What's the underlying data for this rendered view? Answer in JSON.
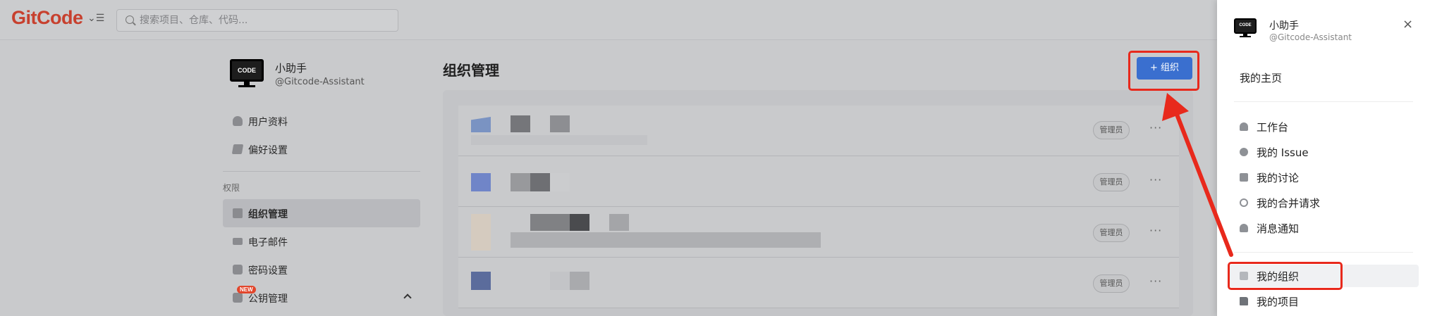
{
  "header": {
    "logo": "GitCode",
    "menu_toggle": "⌄☰",
    "search_placeholder": "搜索项目、仓库、代码..."
  },
  "profile": {
    "avatar_text": "CODE",
    "name": "小助手",
    "handle": "@Gitcode-Assistant"
  },
  "sidebar": {
    "items_top": [
      {
        "label": "用户资料"
      },
      {
        "label": "偏好设置"
      }
    ],
    "section_label": "权限",
    "items": [
      {
        "label": "组织管理"
      },
      {
        "label": "电子邮件"
      },
      {
        "label": "密码设置"
      },
      {
        "label": "公钥管理",
        "badge": "NEW"
      }
    ]
  },
  "main": {
    "title": "组织管理",
    "add_button": "+ 组织",
    "rows": [
      {
        "role": "管理员",
        "more": "···"
      },
      {
        "role": "管理员",
        "more": "···"
      },
      {
        "role": "管理员",
        "more": "···"
      },
      {
        "role": "管理员",
        "more": "···"
      }
    ]
  },
  "drawer": {
    "avatar_text": "CODE",
    "name": "小助手",
    "handle": "@Gitcode-Assistant",
    "close": "×",
    "home": "我的主页",
    "items": [
      {
        "label": "工作台",
        "icon": "user-icon"
      },
      {
        "label": "我的 Issue",
        "icon": "issue-icon"
      },
      {
        "label": "我的讨论",
        "icon": "chat-icon"
      },
      {
        "label": "我的合并请求",
        "icon": "merge-request-icon"
      },
      {
        "label": "消息通知",
        "icon": "bell-icon"
      }
    ],
    "items_bottom": [
      {
        "label": "我的组织",
        "icon": "org-icon"
      },
      {
        "label": "我的项目",
        "icon": "folder-icon"
      }
    ]
  },
  "colors": {
    "accent": "#3a6fcf",
    "logo": "#c7402e",
    "annotation": "#e8291c"
  }
}
